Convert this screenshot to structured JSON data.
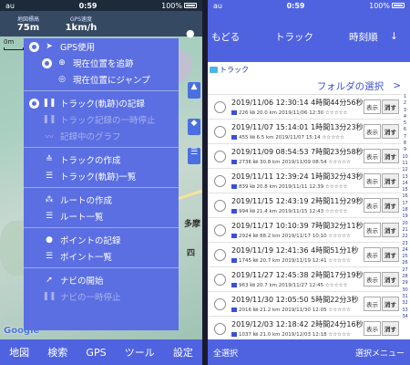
{
  "left": {
    "status": {
      "carrier": "au",
      "time": "0:59",
      "battery": "100%"
    },
    "info": {
      "altitude_label": "地図標高",
      "altitude_value": "75m",
      "speed_label": "GPS速度",
      "speed_value": "1km/h"
    },
    "scale_label": "0m",
    "google": "Google",
    "map_labels": [
      "多摩",
      "四"
    ],
    "gps_menu": [
      {
        "type": "toggle",
        "label": "GPS使用",
        "icon": "nav-arrow-icon"
      },
      {
        "type": "toggle-sub",
        "label": "現在位置を追跡",
        "icon": "crosshair-icon"
      },
      {
        "type": "item-sub",
        "label": "現在位置にジャンプ",
        "icon": "target-icon"
      },
      {
        "type": "sep"
      },
      {
        "type": "toggle",
        "label": "トラック(軌跡)の記録",
        "icon": "pause-icon"
      },
      {
        "type": "disabled",
        "label": "トラック記録の一時停止",
        "icon": "pause-icon"
      },
      {
        "type": "disabled",
        "label": "記録中のグラフ",
        "icon": "graph-icon"
      },
      {
        "type": "sep"
      },
      {
        "type": "item",
        "label": "トラックの作成",
        "icon": "track-create-icon"
      },
      {
        "type": "item",
        "label": "トラック(軌跡)一覧",
        "icon": "list-icon"
      },
      {
        "type": "sep"
      },
      {
        "type": "item",
        "label": "ルートの作成",
        "icon": "route-create-icon"
      },
      {
        "type": "item",
        "label": "ルート一覧",
        "icon": "list-icon"
      },
      {
        "type": "sep"
      },
      {
        "type": "item",
        "label": "ポイントの記録",
        "icon": "pin-icon"
      },
      {
        "type": "item",
        "label": "ポイント一覧",
        "icon": "list-icon"
      },
      {
        "type": "sep"
      },
      {
        "type": "item",
        "label": "ナビの開始",
        "icon": "nav-start-icon"
      },
      {
        "type": "disabled",
        "label": "ナビの一時停止",
        "icon": "pause-icon"
      }
    ],
    "tabs": [
      "地図",
      "検索",
      "GPS",
      "ツール",
      "設定"
    ]
  },
  "right": {
    "status": {
      "carrier": "au",
      "time": "0:59",
      "battery": "100%"
    },
    "nav": {
      "back": "もどる",
      "title": "トラック",
      "sort": "時刻順",
      "arrow": "↓"
    },
    "breadcrumb": "トラック",
    "folder_select": "フォルダの選択",
    "folder_arrow": ">",
    "show_label": "表示",
    "delete_label": "消す",
    "tracks": [
      {
        "title": "2019/11/06 12:30:14 4時間44分56秒",
        "detail": "226 ㎞ 20.0 km 2019/11/06 12:30 ☆☆☆☆☆",
        "color": "#3b4fd8"
      },
      {
        "title": "2019/11/07 15:14:01 1時間13分23秒",
        "detail": "455 ㎞ 6.5 km 2019/11/07 15:14 ☆☆☆☆☆",
        "color": "#3b4fd8"
      },
      {
        "title": "2019/11/09 08:54:53 7時間23分58秒",
        "detail": "2736 ㎞ 30.8 km 2019/11/09 08:54 ☆☆☆☆☆",
        "color": "#3b4fd8"
      },
      {
        "title": "2019/11/11 12:39:24 1時間32分43秒",
        "detail": "839 ㎞ 20.8 km 2019/11/11 12:39 ☆☆☆☆☆",
        "color": "#3b4fd8"
      },
      {
        "title": "2019/11/15 12:43:19 2時間11分29秒",
        "detail": "994 ㎞ 21.4 km 2019/11/15 12:43 ☆☆☆☆☆",
        "color": "#3b4fd8"
      },
      {
        "title": "2019/11/17 10:10:39 7時間32分11秒",
        "detail": "2924 ㎞ 88.2 km 2019/11/17 10:10 ☆☆☆☆☆",
        "color": "#3b4fd8"
      },
      {
        "title": "2019/11/19 12:41:36 4時間51分1秒",
        "detail": "1745 ㎞ 20.7 km 2019/11/19 12:41 ☆☆☆☆☆",
        "color": "#3b4fd8"
      },
      {
        "title": "2019/11/27 12:45:38 2時間17分19秒",
        "detail": "963 ㎞ 20.7 km 2019/11/27 12:45 ☆☆☆☆☆",
        "color": "#3b4fd8"
      },
      {
        "title": "2019/11/30 12:05:50 5時間22分3秒",
        "detail": "2016 ㎞ 21.2 km 2019/11/30 12:05 ☆☆☆☆☆",
        "color": "#3b4fd8"
      },
      {
        "title": "2019/12/03 12:18:42 2時間24分16秒",
        "detail": "1037 ㎞ 21.0 km 2019/12/03 12:18 ☆☆☆☆☆",
        "color": "#3b4fd8"
      }
    ],
    "index_ticks": [
      "1",
      "2",
      "3",
      "4",
      "5",
      "6",
      "7",
      "8",
      "9",
      "10",
      "11",
      "12",
      "13",
      "14",
      "15",
      "16",
      "17",
      "18",
      "19",
      "20",
      "21",
      "22",
      "23",
      "24",
      "25",
      "26",
      "27",
      "28",
      "29",
      "30",
      "31",
      "32",
      "33",
      "34"
    ],
    "bottom": {
      "select_all": "全選択",
      "select_menu": "選択メニュー"
    }
  }
}
